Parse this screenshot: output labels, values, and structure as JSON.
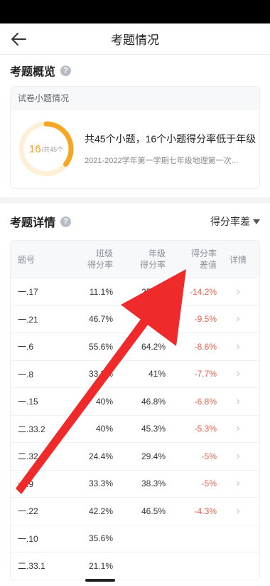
{
  "nav": {
    "title": "考题情况"
  },
  "overview": {
    "title": "考题概览",
    "card_title": "试卷小题情况",
    "ring_count": "16",
    "ring_total": "/共45个",
    "ring_progress": 0.3556,
    "summary": "共45个小题，16个小题得分率低于年级",
    "exam_name": "2021-2022学年第一学期七年级地理第一次..."
  },
  "detail": {
    "title": "考题详情",
    "sort_label": "得分率差",
    "headers": {
      "no": "题号",
      "class_rate_1": "班级",
      "class_rate_2": "得分率",
      "grade_rate_1": "年级",
      "grade_rate_2": "得分率",
      "diff_1": "得分率",
      "diff_2": "差值",
      "detail": "详情"
    },
    "rows": [
      {
        "no": "一.17",
        "class_rate": "11.1%",
        "grade_rate": "25.3%",
        "diff": "-14.2%"
      },
      {
        "no": "一.21",
        "class_rate": "46.7%",
        "grade_rate": "56.2%",
        "diff": "-9.5%"
      },
      {
        "no": "一.6",
        "class_rate": "55.6%",
        "grade_rate": "64.2%",
        "diff": "-8.6%"
      },
      {
        "no": "一.8",
        "class_rate": "33.3%",
        "grade_rate": "41%",
        "diff": "-7.7%"
      },
      {
        "no": "一.15",
        "class_rate": "40%",
        "grade_rate": "46.8%",
        "diff": "-6.8%"
      },
      {
        "no": "二.33.2",
        "class_rate": "40%",
        "grade_rate": "45.3%",
        "diff": "-5.3%"
      },
      {
        "no": "二.32.2",
        "class_rate": "24.4%",
        "grade_rate": "29.4%",
        "diff": "-5%"
      },
      {
        "no": "一.9",
        "class_rate": "33.3%",
        "grade_rate": "38.3%",
        "diff": "-5%"
      },
      {
        "no": "一.22",
        "class_rate": "42.2%",
        "grade_rate": "46.5%",
        "diff": "-4.3%"
      },
      {
        "no": "一.10",
        "class_rate": "35.6%",
        "grade_rate": "",
        "diff": ""
      },
      {
        "no": "二.33.1",
        "class_rate": "21.1%",
        "grade_rate": "",
        "diff": ""
      }
    ]
  },
  "colors": {
    "accent": "#f5a623",
    "negative": "#e8624a",
    "arrow": "#ee2a2a"
  }
}
